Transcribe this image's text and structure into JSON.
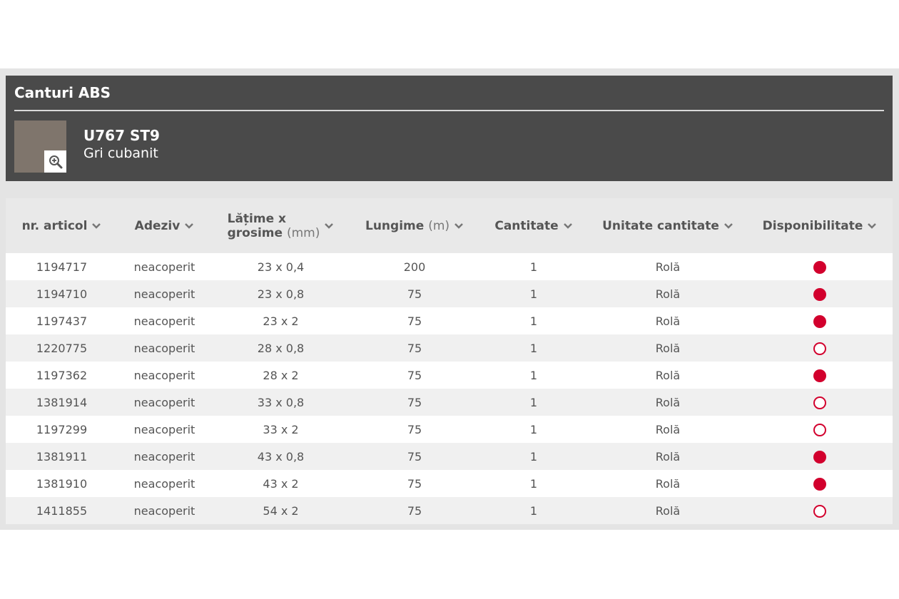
{
  "panel": {
    "title": "Canturi ABS",
    "product_code": "U767 ST9",
    "product_name": "Gri cubanit",
    "swatch_color": "#7f756c",
    "zoom_icon": "zoom-in-icon"
  },
  "table": {
    "columns": [
      {
        "label": "nr. articol",
        "unit": ""
      },
      {
        "label": "Adeziv",
        "unit": ""
      },
      {
        "label_line1": "Lățime x",
        "label_line2": "grosime",
        "unit": "(mm)"
      },
      {
        "label": "Lungime",
        "unit": "(m)"
      },
      {
        "label": "Cantitate",
        "unit": ""
      },
      {
        "label": "Unitate cantitate",
        "unit": ""
      },
      {
        "label": "Disponibilitate",
        "unit": ""
      }
    ],
    "rows": [
      {
        "article": "1194717",
        "adhesive": "neacoperit",
        "size": "23 x 0,4",
        "length": "200",
        "qty": "1",
        "unit": "Rolă",
        "available": true
      },
      {
        "article": "1194710",
        "adhesive": "neacoperit",
        "size": "23 x 0,8",
        "length": "75",
        "qty": "1",
        "unit": "Rolă",
        "available": true
      },
      {
        "article": "1197437",
        "adhesive": "neacoperit",
        "size": "23 x 2",
        "length": "75",
        "qty": "1",
        "unit": "Rolă",
        "available": true
      },
      {
        "article": "1220775",
        "adhesive": "neacoperit",
        "size": "28 x 0,8",
        "length": "75",
        "qty": "1",
        "unit": "Rolă",
        "available": false
      },
      {
        "article": "1197362",
        "adhesive": "neacoperit",
        "size": "28 x 2",
        "length": "75",
        "qty": "1",
        "unit": "Rolă",
        "available": true
      },
      {
        "article": "1381914",
        "adhesive": "neacoperit",
        "size": "33 x 0,8",
        "length": "75",
        "qty": "1",
        "unit": "Rolă",
        "available": false
      },
      {
        "article": "1197299",
        "adhesive": "neacoperit",
        "size": "33 x 2",
        "length": "75",
        "qty": "1",
        "unit": "Rolă",
        "available": false
      },
      {
        "article": "1381911",
        "adhesive": "neacoperit",
        "size": "43 x 0,8",
        "length": "75",
        "qty": "1",
        "unit": "Rolă",
        "available": true
      },
      {
        "article": "1381910",
        "adhesive": "neacoperit",
        "size": "43 x 2",
        "length": "75",
        "qty": "1",
        "unit": "Rolă",
        "available": true
      },
      {
        "article": "1411855",
        "adhesive": "neacoperit",
        "size": "54 x 2",
        "length": "75",
        "qty": "1",
        "unit": "Rolă",
        "available": false
      }
    ]
  },
  "colors": {
    "accent_red": "#d2002d",
    "panel_bg": "#4a4a4a",
    "header_bg": "#e9e9e9",
    "row_alt_bg": "#f0f0f0"
  },
  "icons": {
    "sort": "chevron-down-icon",
    "available": "filled-dot-icon",
    "unavailable": "empty-dot-icon"
  }
}
